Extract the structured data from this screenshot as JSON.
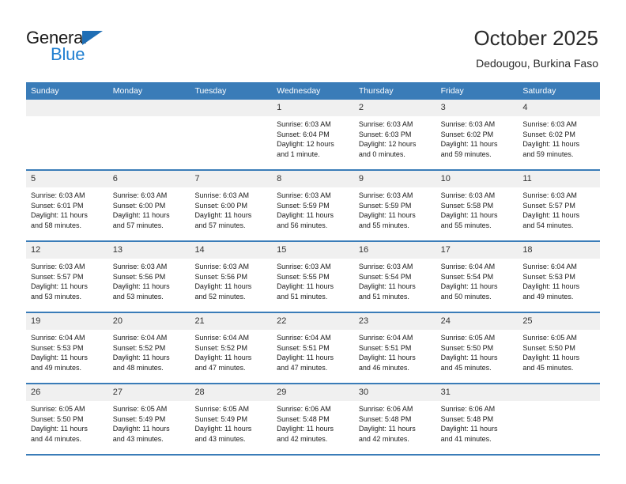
{
  "brand": {
    "name_top": "General",
    "name_bottom": "Blue",
    "accent_color": "#1f7ed0",
    "header_color": "#3a7cb8"
  },
  "header": {
    "title": "October 2025",
    "subtitle": "Dedougou, Burkina Faso"
  },
  "calendar": {
    "weekday_headers": [
      "Sunday",
      "Monday",
      "Tuesday",
      "Wednesday",
      "Thursday",
      "Friday",
      "Saturday"
    ],
    "weeks": [
      [
        {
          "day": "",
          "sunrise": "",
          "sunset": "",
          "daylight_line1": "",
          "daylight_line2": "",
          "empty": true
        },
        {
          "day": "",
          "sunrise": "",
          "sunset": "",
          "daylight_line1": "",
          "daylight_line2": "",
          "empty": true
        },
        {
          "day": "",
          "sunrise": "",
          "sunset": "",
          "daylight_line1": "",
          "daylight_line2": "",
          "empty": true
        },
        {
          "day": "1",
          "sunrise": "Sunrise: 6:03 AM",
          "sunset": "Sunset: 6:04 PM",
          "daylight_line1": "Daylight: 12 hours",
          "daylight_line2": "and 1 minute."
        },
        {
          "day": "2",
          "sunrise": "Sunrise: 6:03 AM",
          "sunset": "Sunset: 6:03 PM",
          "daylight_line1": "Daylight: 12 hours",
          "daylight_line2": "and 0 minutes."
        },
        {
          "day": "3",
          "sunrise": "Sunrise: 6:03 AM",
          "sunset": "Sunset: 6:02 PM",
          "daylight_line1": "Daylight: 11 hours",
          "daylight_line2": "and 59 minutes."
        },
        {
          "day": "4",
          "sunrise": "Sunrise: 6:03 AM",
          "sunset": "Sunset: 6:02 PM",
          "daylight_line1": "Daylight: 11 hours",
          "daylight_line2": "and 59 minutes."
        }
      ],
      [
        {
          "day": "5",
          "sunrise": "Sunrise: 6:03 AM",
          "sunset": "Sunset: 6:01 PM",
          "daylight_line1": "Daylight: 11 hours",
          "daylight_line2": "and 58 minutes."
        },
        {
          "day": "6",
          "sunrise": "Sunrise: 6:03 AM",
          "sunset": "Sunset: 6:00 PM",
          "daylight_line1": "Daylight: 11 hours",
          "daylight_line2": "and 57 minutes."
        },
        {
          "day": "7",
          "sunrise": "Sunrise: 6:03 AM",
          "sunset": "Sunset: 6:00 PM",
          "daylight_line1": "Daylight: 11 hours",
          "daylight_line2": "and 57 minutes."
        },
        {
          "day": "8",
          "sunrise": "Sunrise: 6:03 AM",
          "sunset": "Sunset: 5:59 PM",
          "daylight_line1": "Daylight: 11 hours",
          "daylight_line2": "and 56 minutes."
        },
        {
          "day": "9",
          "sunrise": "Sunrise: 6:03 AM",
          "sunset": "Sunset: 5:59 PM",
          "daylight_line1": "Daylight: 11 hours",
          "daylight_line2": "and 55 minutes."
        },
        {
          "day": "10",
          "sunrise": "Sunrise: 6:03 AM",
          "sunset": "Sunset: 5:58 PM",
          "daylight_line1": "Daylight: 11 hours",
          "daylight_line2": "and 55 minutes."
        },
        {
          "day": "11",
          "sunrise": "Sunrise: 6:03 AM",
          "sunset": "Sunset: 5:57 PM",
          "daylight_line1": "Daylight: 11 hours",
          "daylight_line2": "and 54 minutes."
        }
      ],
      [
        {
          "day": "12",
          "sunrise": "Sunrise: 6:03 AM",
          "sunset": "Sunset: 5:57 PM",
          "daylight_line1": "Daylight: 11 hours",
          "daylight_line2": "and 53 minutes."
        },
        {
          "day": "13",
          "sunrise": "Sunrise: 6:03 AM",
          "sunset": "Sunset: 5:56 PM",
          "daylight_line1": "Daylight: 11 hours",
          "daylight_line2": "and 53 minutes."
        },
        {
          "day": "14",
          "sunrise": "Sunrise: 6:03 AM",
          "sunset": "Sunset: 5:56 PM",
          "daylight_line1": "Daylight: 11 hours",
          "daylight_line2": "and 52 minutes."
        },
        {
          "day": "15",
          "sunrise": "Sunrise: 6:03 AM",
          "sunset": "Sunset: 5:55 PM",
          "daylight_line1": "Daylight: 11 hours",
          "daylight_line2": "and 51 minutes."
        },
        {
          "day": "16",
          "sunrise": "Sunrise: 6:03 AM",
          "sunset": "Sunset: 5:54 PM",
          "daylight_line1": "Daylight: 11 hours",
          "daylight_line2": "and 51 minutes."
        },
        {
          "day": "17",
          "sunrise": "Sunrise: 6:04 AM",
          "sunset": "Sunset: 5:54 PM",
          "daylight_line1": "Daylight: 11 hours",
          "daylight_line2": "and 50 minutes."
        },
        {
          "day": "18",
          "sunrise": "Sunrise: 6:04 AM",
          "sunset": "Sunset: 5:53 PM",
          "daylight_line1": "Daylight: 11 hours",
          "daylight_line2": "and 49 minutes."
        }
      ],
      [
        {
          "day": "19",
          "sunrise": "Sunrise: 6:04 AM",
          "sunset": "Sunset: 5:53 PM",
          "daylight_line1": "Daylight: 11 hours",
          "daylight_line2": "and 49 minutes."
        },
        {
          "day": "20",
          "sunrise": "Sunrise: 6:04 AM",
          "sunset": "Sunset: 5:52 PM",
          "daylight_line1": "Daylight: 11 hours",
          "daylight_line2": "and 48 minutes."
        },
        {
          "day": "21",
          "sunrise": "Sunrise: 6:04 AM",
          "sunset": "Sunset: 5:52 PM",
          "daylight_line1": "Daylight: 11 hours",
          "daylight_line2": "and 47 minutes."
        },
        {
          "day": "22",
          "sunrise": "Sunrise: 6:04 AM",
          "sunset": "Sunset: 5:51 PM",
          "daylight_line1": "Daylight: 11 hours",
          "daylight_line2": "and 47 minutes."
        },
        {
          "day": "23",
          "sunrise": "Sunrise: 6:04 AM",
          "sunset": "Sunset: 5:51 PM",
          "daylight_line1": "Daylight: 11 hours",
          "daylight_line2": "and 46 minutes."
        },
        {
          "day": "24",
          "sunrise": "Sunrise: 6:05 AM",
          "sunset": "Sunset: 5:50 PM",
          "daylight_line1": "Daylight: 11 hours",
          "daylight_line2": "and 45 minutes."
        },
        {
          "day": "25",
          "sunrise": "Sunrise: 6:05 AM",
          "sunset": "Sunset: 5:50 PM",
          "daylight_line1": "Daylight: 11 hours",
          "daylight_line2": "and 45 minutes."
        }
      ],
      [
        {
          "day": "26",
          "sunrise": "Sunrise: 6:05 AM",
          "sunset": "Sunset: 5:50 PM",
          "daylight_line1": "Daylight: 11 hours",
          "daylight_line2": "and 44 minutes."
        },
        {
          "day": "27",
          "sunrise": "Sunrise: 6:05 AM",
          "sunset": "Sunset: 5:49 PM",
          "daylight_line1": "Daylight: 11 hours",
          "daylight_line2": "and 43 minutes."
        },
        {
          "day": "28",
          "sunrise": "Sunrise: 6:05 AM",
          "sunset": "Sunset: 5:49 PM",
          "daylight_line1": "Daylight: 11 hours",
          "daylight_line2": "and 43 minutes."
        },
        {
          "day": "29",
          "sunrise": "Sunrise: 6:06 AM",
          "sunset": "Sunset: 5:48 PM",
          "daylight_line1": "Daylight: 11 hours",
          "daylight_line2": "and 42 minutes."
        },
        {
          "day": "30",
          "sunrise": "Sunrise: 6:06 AM",
          "sunset": "Sunset: 5:48 PM",
          "daylight_line1": "Daylight: 11 hours",
          "daylight_line2": "and 42 minutes."
        },
        {
          "day": "31",
          "sunrise": "Sunrise: 6:06 AM",
          "sunset": "Sunset: 5:48 PM",
          "daylight_line1": "Daylight: 11 hours",
          "daylight_line2": "and 41 minutes."
        },
        {
          "day": "",
          "sunrise": "",
          "sunset": "",
          "daylight_line1": "",
          "daylight_line2": "",
          "empty": true
        }
      ]
    ]
  }
}
